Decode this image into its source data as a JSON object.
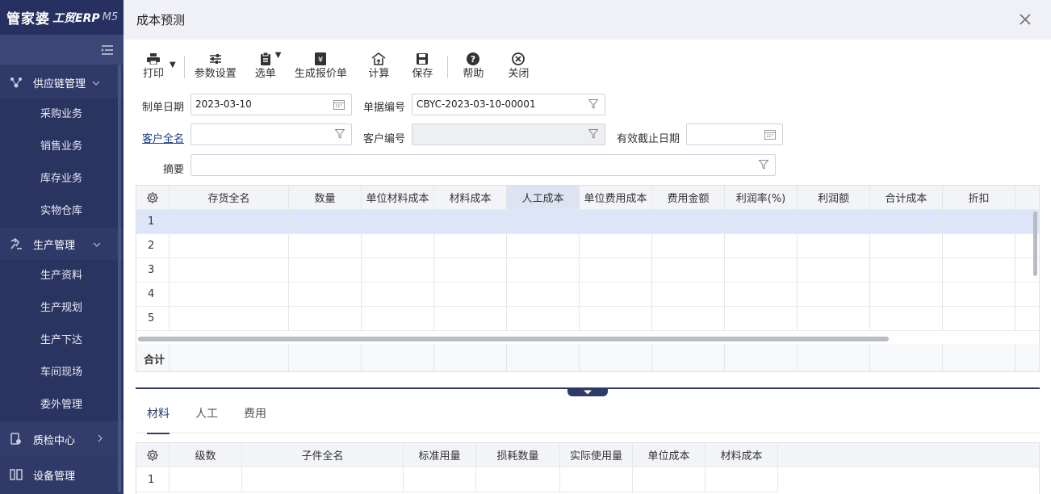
{
  "app": {
    "brand": "管家婆",
    "brand_sub": "工贸ERP",
    "version": "M5"
  },
  "sidebar": {
    "groups": [
      {
        "label": "供应链管理",
        "icon": "supply-chain-icon",
        "items": [
          "采购业务",
          "销售业务",
          "库存业务",
          "实物仓库"
        ]
      },
      {
        "label": "生产管理",
        "icon": "production-icon",
        "items": [
          "生产资料",
          "生产规划",
          "生产下达",
          "车间现场",
          "委外管理"
        ]
      },
      {
        "label": "质检中心",
        "icon": "quality-icon"
      },
      {
        "label": "设备管理",
        "icon": "equipment-icon"
      }
    ]
  },
  "window": {
    "title": "成本预测"
  },
  "toolbar": {
    "print": "打印",
    "params": "参数设置",
    "select": "选单",
    "gen_quote": "生成报价单",
    "calc": "计算",
    "save": "保存",
    "help": "帮助",
    "close": "关闭"
  },
  "form": {
    "date_label": "制单日期",
    "date_value": "2023-03-10",
    "docno_label": "单据编号",
    "docno_value": "CBYC-2023-03-10-00001",
    "customer_label": "客户全名",
    "customer_value": "",
    "customer_code_label": "客户编号",
    "customer_code_value": "",
    "valid_until_label": "有效截止日期",
    "valid_until_value": "",
    "summary_label": "摘要",
    "summary_value": ""
  },
  "grid": {
    "columns": [
      "存货全名",
      "数量",
      "单位材料成本",
      "材料成本",
      "人工成本",
      "单位费用成本",
      "费用金额",
      "利润率(%)",
      "利润额",
      "合计成本",
      "折扣"
    ],
    "rows": [
      "1",
      "2",
      "3",
      "4",
      "5"
    ],
    "total_label": "合计"
  },
  "tabs": [
    "材料",
    "人工",
    "费用"
  ],
  "subgrid": {
    "columns": [
      "级数",
      "子件全名",
      "标准用量",
      "损耗数量",
      "实际使用量",
      "单位成本",
      "材料成本"
    ],
    "rows": [
      "1"
    ]
  }
}
